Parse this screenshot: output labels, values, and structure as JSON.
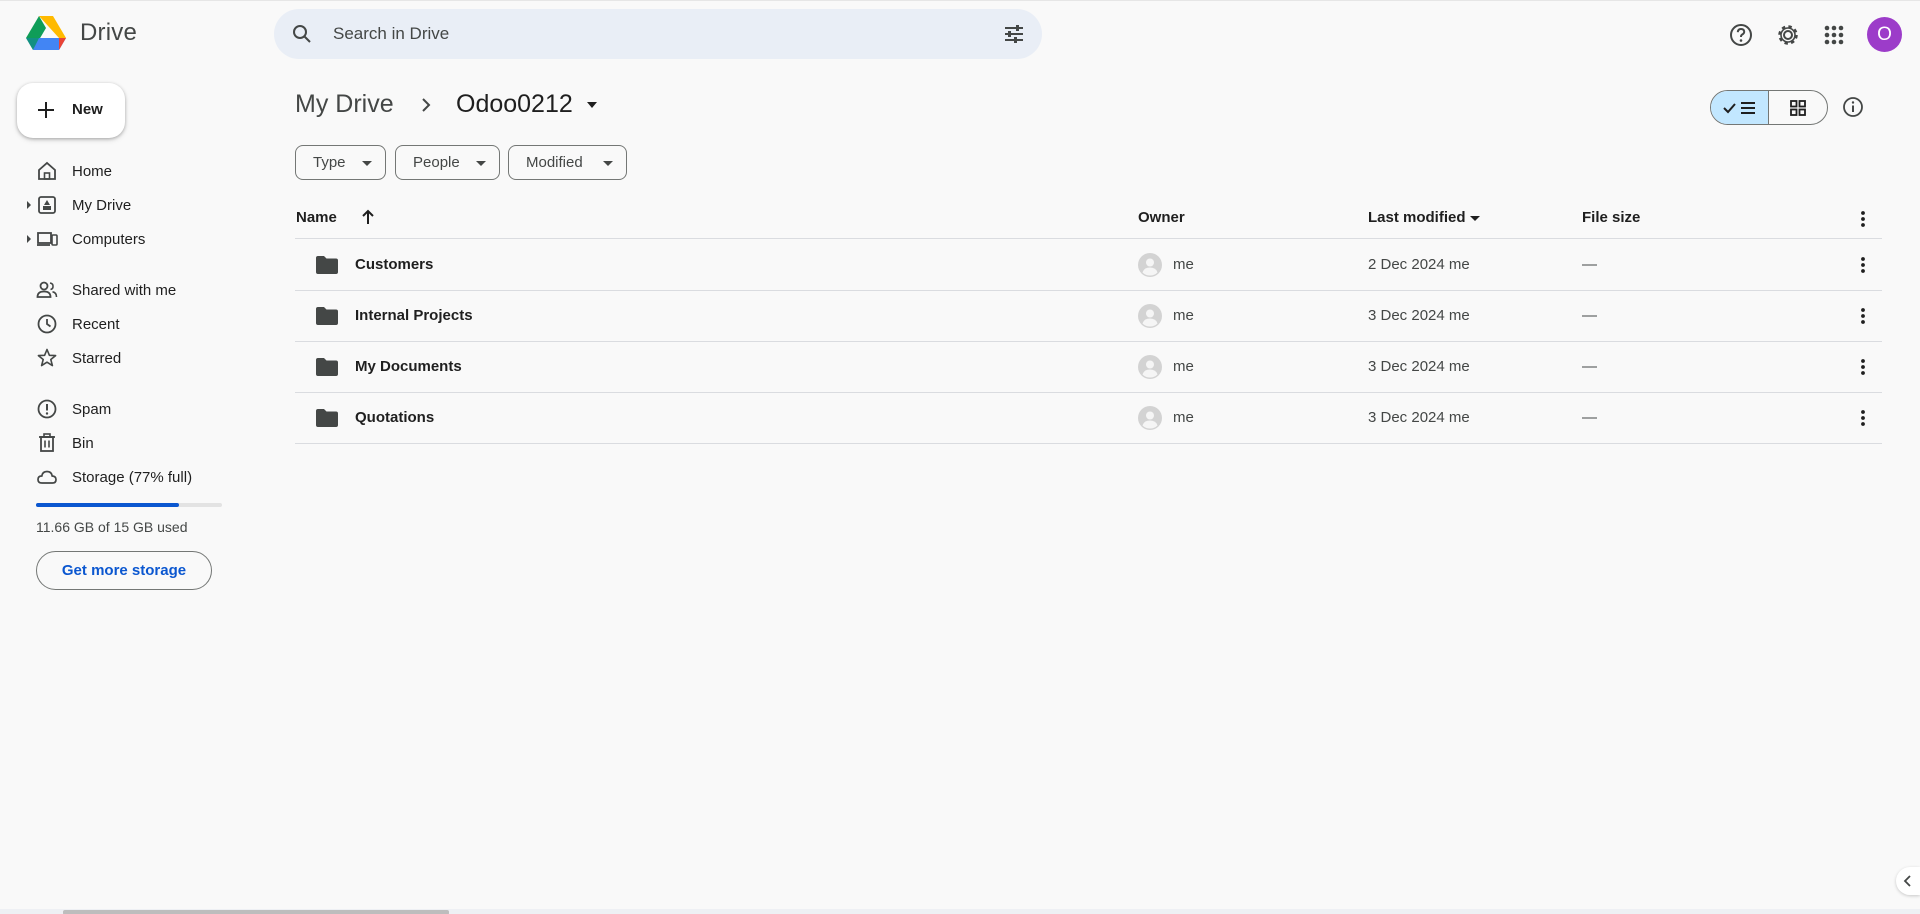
{
  "app": {
    "brand": "Drive",
    "avatar_letter": "O",
    "avatar_color": "#9c3cc9"
  },
  "search": {
    "placeholder": "Search in Drive"
  },
  "sidebar": {
    "new_label": "New",
    "items": [
      {
        "label": "Home",
        "icon": "home-icon"
      },
      {
        "label": "My Drive",
        "icon": "my-drive-icon"
      },
      {
        "label": "Computers",
        "icon": "computers-icon"
      },
      {
        "label": "Shared with me",
        "icon": "shared-icon"
      },
      {
        "label": "Recent",
        "icon": "clock-icon"
      },
      {
        "label": "Starred",
        "icon": "star-icon"
      },
      {
        "label": "Spam",
        "icon": "spam-icon"
      },
      {
        "label": "Bin",
        "icon": "trash-icon"
      },
      {
        "label": "Storage (77% full)",
        "icon": "cloud-icon"
      }
    ],
    "storage_used_fraction": 0.77,
    "storage_text": "11.66 GB of 15 GB used",
    "get_more_storage": "Get more storage"
  },
  "breadcrumb": {
    "root": "My Drive",
    "current": "Odoo0212"
  },
  "filters": [
    "Type",
    "People",
    "Modified"
  ],
  "table": {
    "columns": {
      "name": "Name",
      "owner": "Owner",
      "modified": "Last modified",
      "size": "File size"
    },
    "rows": [
      {
        "name": "Customers",
        "owner": "me",
        "modified": "2 Dec 2024  me",
        "size": "—"
      },
      {
        "name": "Internal Projects",
        "owner": "me",
        "modified": "3 Dec 2024  me",
        "size": "—"
      },
      {
        "name": "My Documents",
        "owner": "me",
        "modified": "3 Dec 2024  me",
        "size": "—"
      },
      {
        "name": "Quotations",
        "owner": "me",
        "modified": "3 Dec 2024  me",
        "size": "—"
      }
    ]
  },
  "colors": {
    "accent": "#0b57d0",
    "selected_view": "#c2e7ff",
    "search_bg": "#e9eef6"
  }
}
